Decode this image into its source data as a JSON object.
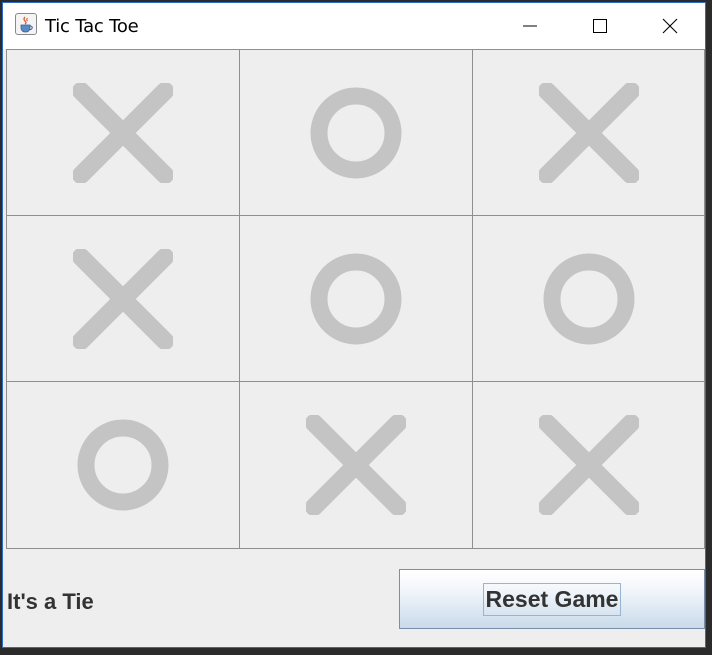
{
  "window": {
    "title": "Tic Tac Toe",
    "icon": "java-cup-icon"
  },
  "controls": {
    "minimize": "minimize-icon",
    "maximize": "maximize-icon",
    "close": "close-icon"
  },
  "board": {
    "cells": [
      "X",
      "O",
      "X",
      "X",
      "O",
      "O",
      "O",
      "X",
      "X"
    ],
    "mark_color": "#c4c4c4"
  },
  "status": {
    "text": "It's a Tie"
  },
  "reset": {
    "label": "Reset Game"
  }
}
